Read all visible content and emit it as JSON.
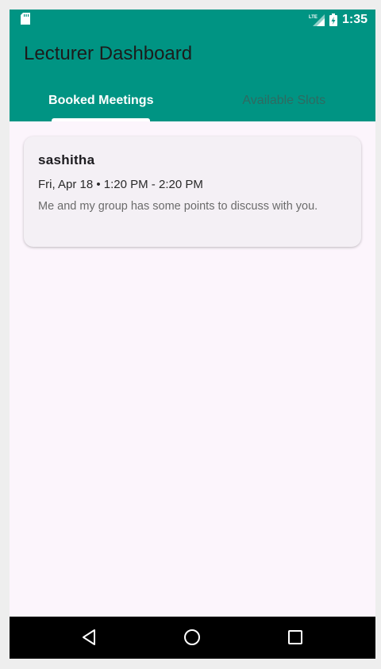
{
  "status_bar": {
    "time": "1:35",
    "network_label": "LTE",
    "icons": [
      "sd-card-icon",
      "lte-signal-icon",
      "battery-charging-icon"
    ]
  },
  "app_bar": {
    "title": "Lecturer Dashboard",
    "tabs": [
      {
        "label": "Booked Meetings",
        "selected": true
      },
      {
        "label": "Available Slots",
        "selected": false
      }
    ]
  },
  "meetings": [
    {
      "name": "sashitha",
      "time": "Fri, Apr 18 • 1:20 PM - 2:20 PM",
      "description": "Me and my group has some points to discuss with you."
    }
  ],
  "nav_bar": {
    "icons": [
      "back-icon",
      "home-icon",
      "recents-icon"
    ]
  },
  "colors": {
    "primary": "#009483",
    "background": "#fcf5fc",
    "card": "#f4f0f5",
    "nav_bar": "#000000"
  }
}
